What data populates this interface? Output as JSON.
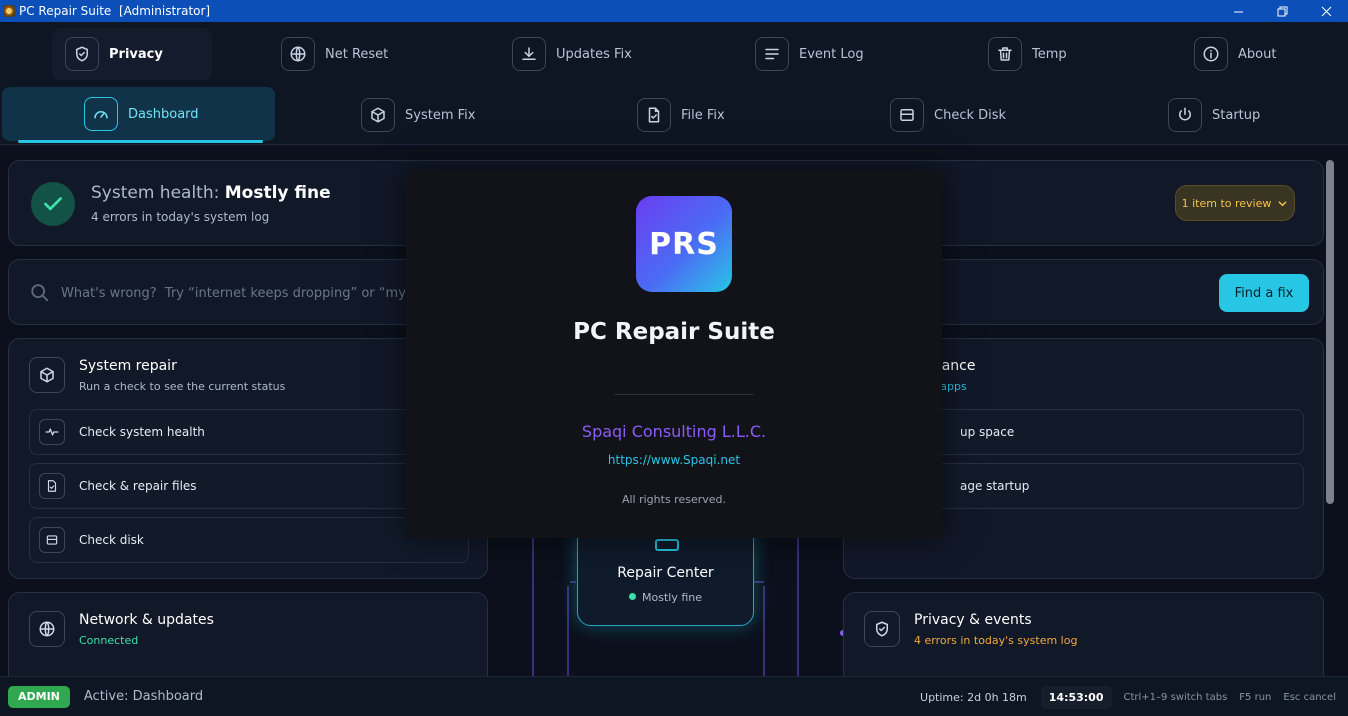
{
  "window": {
    "title": "PC Repair Suite  [Administrator]"
  },
  "nav": {
    "row1": [
      {
        "label": "Privacy",
        "icon": "shield-icon"
      },
      {
        "label": "Net Reset",
        "icon": "globe-icon"
      },
      {
        "label": "Updates Fix",
        "icon": "download-icon"
      },
      {
        "label": "Event Log",
        "icon": "list-icon"
      },
      {
        "label": "Temp",
        "icon": "trash-icon"
      },
      {
        "label": "About",
        "icon": "info-icon"
      }
    ],
    "row2": [
      {
        "label": "Dashboard",
        "icon": "gauge-icon"
      },
      {
        "label": "System Fix",
        "icon": "cube-icon"
      },
      {
        "label": "File Fix",
        "icon": "file-check-icon"
      },
      {
        "label": "Check Disk",
        "icon": "disk-icon"
      },
      {
        "label": "Startup",
        "icon": "power-icon"
      }
    ]
  },
  "health": {
    "prefix": "System health: ",
    "status": "Mostly fine",
    "subtitle": "4 errors in today's system log",
    "review_label": "1 item to review"
  },
  "search": {
    "placeholder": "What's wrong?  Try “internet keeps dropping” or “my l",
    "button": "Find a fix"
  },
  "system_repair": {
    "title": "System repair",
    "subtitle": "Run a check to see the current status",
    "items": [
      {
        "label": "Check system health",
        "icon": "pulse-icon"
      },
      {
        "label": "Check & repair files",
        "icon": "file-check-icon"
      },
      {
        "label": "Check disk",
        "icon": "disk-icon"
      }
    ]
  },
  "performance": {
    "title": "ormance",
    "subtitle": "rtup apps",
    "items": [
      {
        "label": "up space"
      },
      {
        "label": "age startup"
      }
    ]
  },
  "network": {
    "title": "Network & updates",
    "subtitle": "Connected"
  },
  "privacy_events": {
    "title": "Privacy & events",
    "subtitle": "4 errors in today's system log"
  },
  "repair_center": {
    "title": "Repair Center",
    "status": "Mostly fine"
  },
  "splash": {
    "logo_text": "PRS",
    "title": "PC Repair Suite",
    "company": "Spaqi Consulting L.L.C.",
    "url": "https://www.Spaqi.net",
    "rights": "All rights reserved."
  },
  "status": {
    "badge": "ADMIN",
    "active": "Active: Dashboard",
    "uptime": "Uptime: 2d 0h 18m",
    "clock": "14:53:00",
    "hint_tabs": "Ctrl+1–9  switch tabs",
    "hint_run": "F5  run",
    "hint_cancel": "Esc  cancel"
  },
  "colors": {
    "accent": "#27c6e5",
    "success": "#3ee0a9",
    "warning": "#f2c14e",
    "brand_purple": "#8b5cf6",
    "titlebar": "#0d4fb8"
  }
}
